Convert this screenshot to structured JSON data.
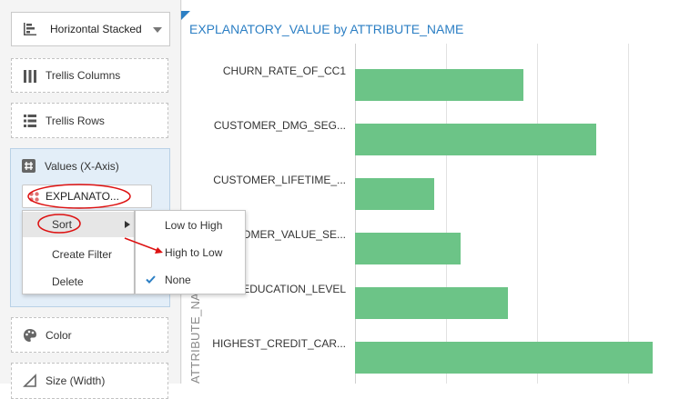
{
  "left_panel": {
    "chart_type": {
      "label": "Horizontal Stacked"
    },
    "trellis_columns": {
      "label": "Trellis Columns"
    },
    "trellis_rows": {
      "label": "Trellis Rows"
    },
    "values_x_axis": {
      "label": "Values (X-Axis)",
      "chip_label": "EXPLANATO..."
    },
    "color": {
      "label": "Color"
    },
    "size": {
      "label": "Size (Width)"
    }
  },
  "context_menu": {
    "items": [
      "Sort",
      "Create Filter",
      "Delete"
    ],
    "sort_submenu": {
      "items": [
        "Low to High",
        "High to Low",
        "None"
      ],
      "checked": "None"
    }
  },
  "colors": {
    "bar": "#6cc487",
    "accent": "#2c7fc4",
    "annotation": "#dd1111",
    "check": "#2c7fc4"
  },
  "icons": [
    "bar-chart-icon",
    "dropdown-arrow-icon",
    "trellis-columns-icon",
    "trellis-rows-icon",
    "hash-icon",
    "measure-icon",
    "submenu-arrow-icon",
    "checkmark-icon",
    "palette-icon",
    "size-icon"
  ],
  "chart_data": {
    "type": "bar",
    "orientation": "horizontal",
    "title": "EXPLANATORY_VALUE by ATTRIBUTE_NAME",
    "ylabel": "ATTRIBUTE_NAME",
    "categories": [
      "CHURN_RATE_OF_CC1",
      "CUSTOMER_DMG_SEG...",
      "CUSTOMER_LIFETIME_...",
      "CUSTOMER_VALUE_SE...",
      "EDUCATION_LEVEL",
      "HIGHEST_CREDIT_CAR..."
    ],
    "values": [
      0.185,
      0.265,
      0.087,
      0.116,
      0.168,
      0.327
    ],
    "xlim": [
      0,
      0.38
    ],
    "gridlines_x": [
      0.1,
      0.2,
      0.3
    ],
    "grid": true
  }
}
